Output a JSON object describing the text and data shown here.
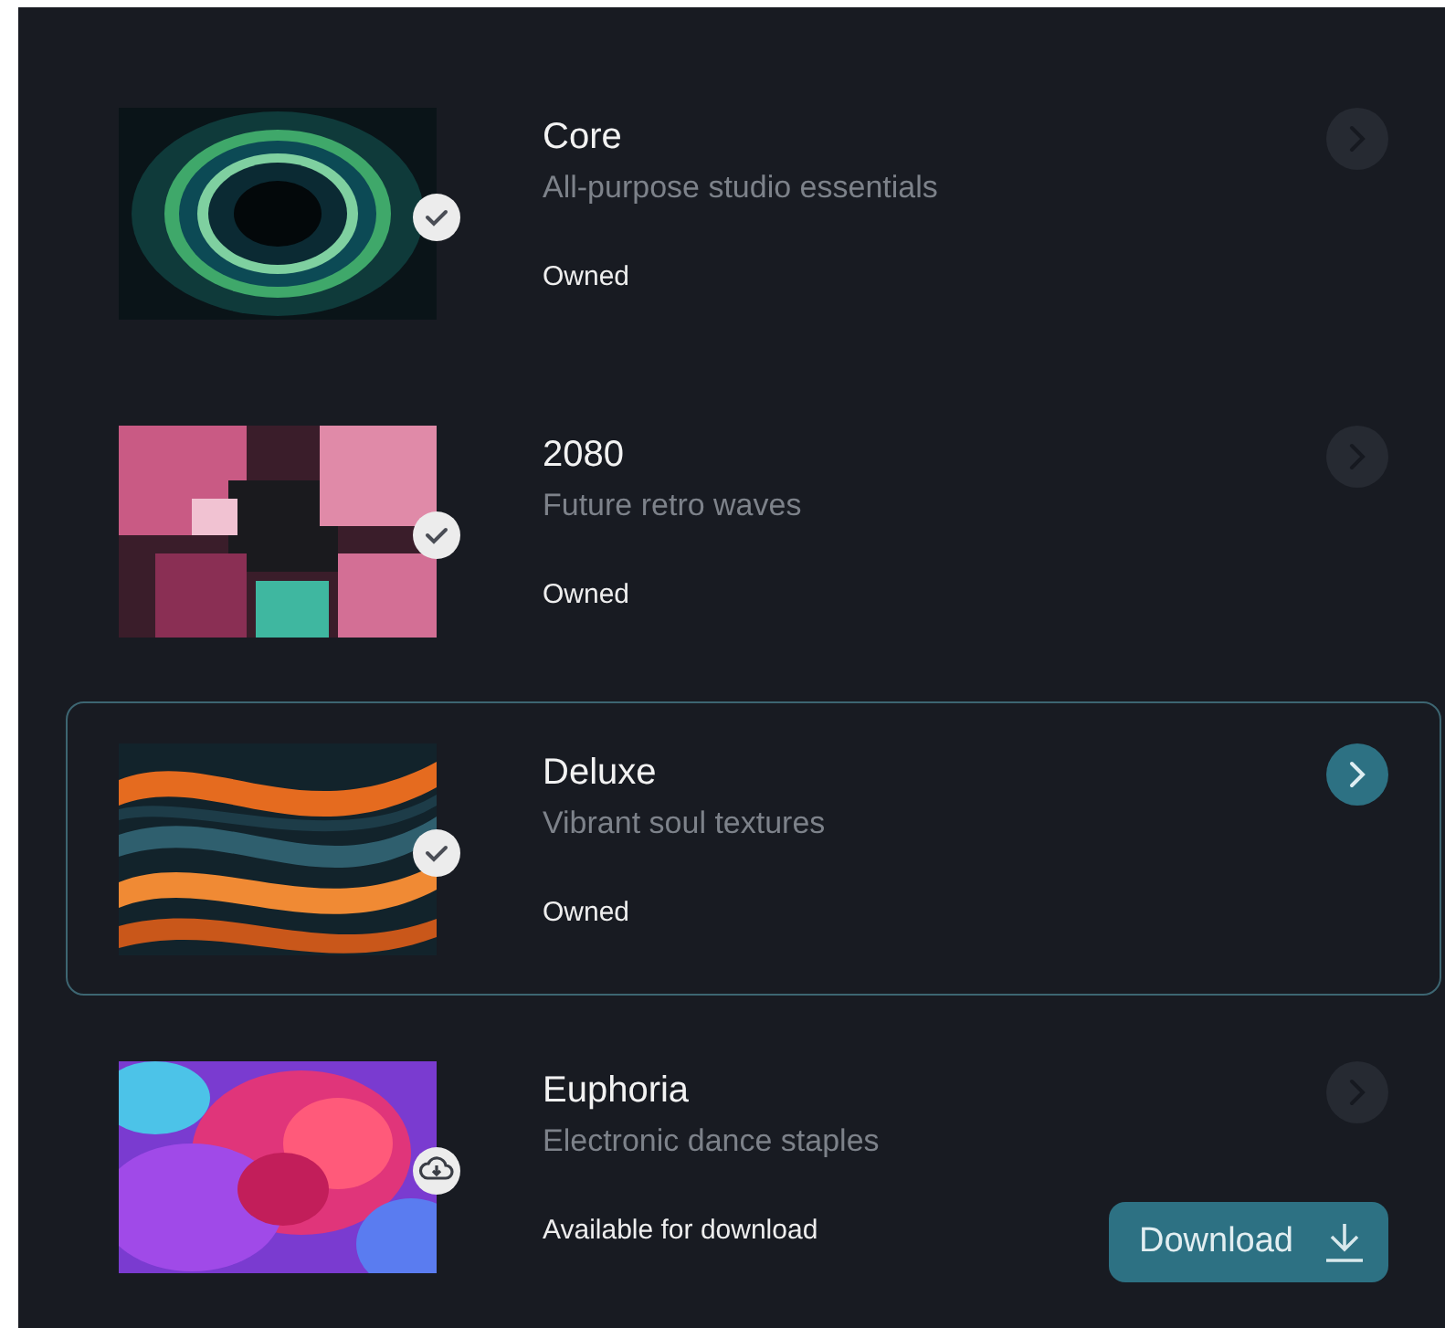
{
  "items": [
    {
      "title": "Core",
      "subtitle": "All-purpose studio essentials",
      "status": "Owned",
      "kind": "owned",
      "selected": false
    },
    {
      "title": "2080",
      "subtitle": "Future retro waves",
      "status": "Owned",
      "kind": "owned",
      "selected": false
    },
    {
      "title": "Deluxe",
      "subtitle": "Vibrant soul textures",
      "status": "Owned",
      "kind": "owned",
      "selected": true
    },
    {
      "title": "Euphoria",
      "subtitle": "Electronic dance staples",
      "status": "Available for download",
      "kind": "downloadable",
      "selected": false,
      "button": "Download"
    }
  ]
}
